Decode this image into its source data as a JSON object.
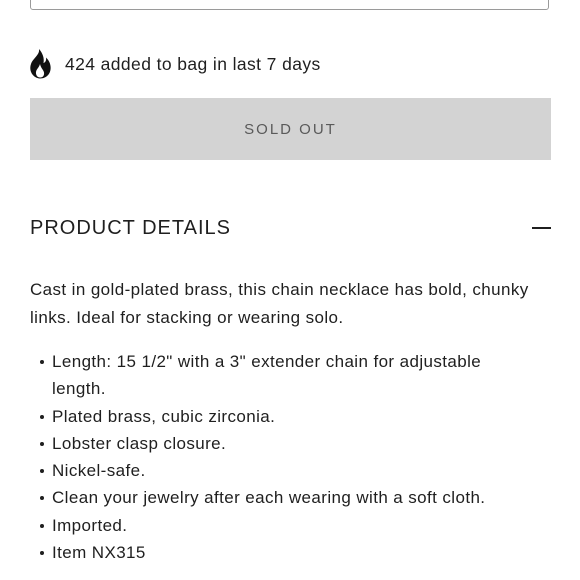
{
  "popularity": {
    "icon": "fire-icon",
    "text": "424 added to bag in last 7 days"
  },
  "sold_out_button": {
    "label": "SOLD OUT"
  },
  "product_details": {
    "title": "PRODUCT DETAILS",
    "toggle_icon": "minus-icon",
    "description": "Cast in gold-plated brass, this chain necklace has bold, chunky links. Ideal for stacking or wearing solo.",
    "bullets": [
      "Length: 15 1/2\" with a 3\" extender chain for adjustable length.",
      "Plated brass, cubic zirconia.",
      "Lobster clasp closure.",
      "Nickel-safe.",
      "Clean your jewelry after each wearing with a soft cloth.",
      "Imported.",
      "Item NX315"
    ]
  },
  "colors": {
    "text": "#1f1f1f",
    "sold_out_bg": "#d3d3d3",
    "sold_out_text": "#5a5a5a"
  }
}
